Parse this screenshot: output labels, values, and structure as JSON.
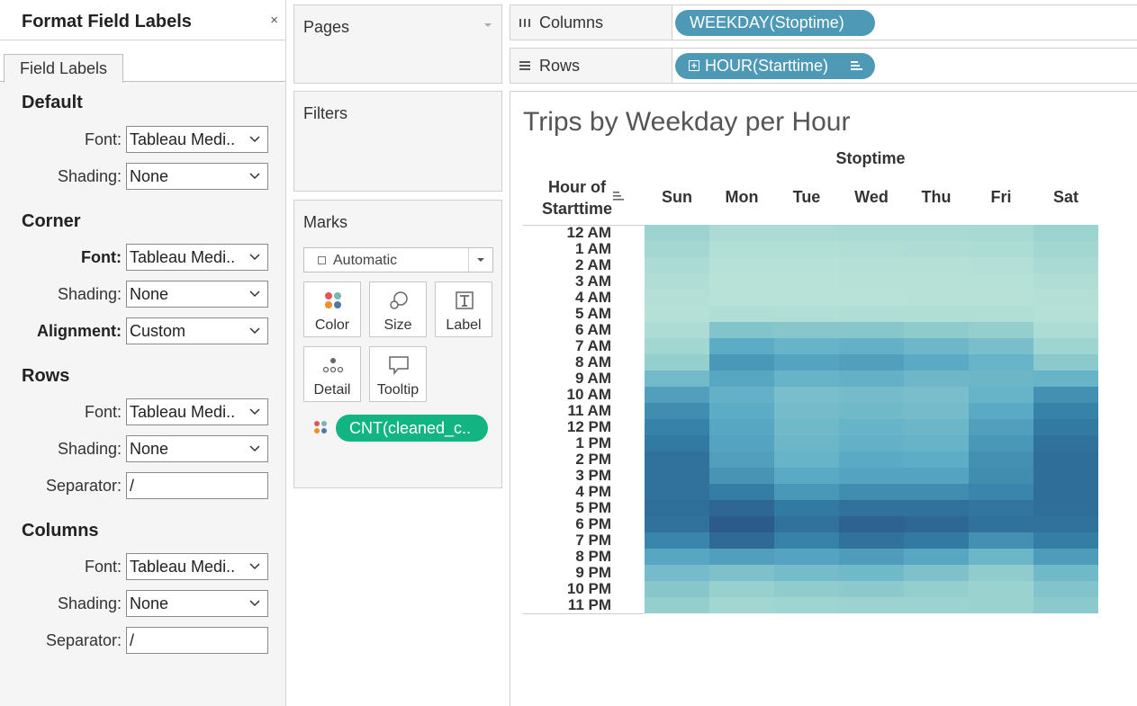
{
  "format_panel": {
    "title": "Format Field Labels",
    "close_glyph": "×",
    "tab": "Field Labels",
    "sections": {
      "default": {
        "title": "Default",
        "font_label": "Font:",
        "font_value": "Tableau Medi..",
        "shading_label": "Shading:",
        "shading_value": "None"
      },
      "corner": {
        "title": "Corner",
        "font_label": "Font:",
        "font_value": "Tableau Medi..",
        "shading_label": "Shading:",
        "shading_value": "None",
        "alignment_label": "Alignment:",
        "alignment_value": "Custom"
      },
      "rows": {
        "title": "Rows",
        "font_label": "Font:",
        "font_value": "Tableau Medi..",
        "shading_label": "Shading:",
        "shading_value": "None",
        "separator_label": "Separator:",
        "separator_value": "/"
      },
      "columns": {
        "title": "Columns",
        "font_label": "Font:",
        "font_value": "Tableau Medi..",
        "shading_label": "Shading:",
        "shading_value": "None",
        "separator_label": "Separator:",
        "separator_value": "/"
      }
    }
  },
  "pages": {
    "title": "Pages"
  },
  "filters": {
    "title": "Filters"
  },
  "marks": {
    "title": "Marks",
    "mark_type": "Automatic",
    "buttons": {
      "color": "Color",
      "size": "Size",
      "label": "Label",
      "detail": "Detail",
      "tooltip": "Tooltip"
    },
    "color_pill": "CNT(cleaned_c.."
  },
  "shelves": {
    "columns": {
      "label": "Columns",
      "pill": "WEEKDAY(Stoptime)"
    },
    "rows": {
      "label": "Rows",
      "pill": "HOUR(Starttime)"
    }
  },
  "view": {
    "title": "Trips by Weekday per Hour",
    "column_field": "Stoptime",
    "row_field": "Hour of Starttime",
    "row_field_line1": "Hour of",
    "row_field_line2": "Starttime"
  },
  "colors": {
    "pill_blue": "#4e99b6",
    "pill_green": "#12b582",
    "color_ramp_low": "#bce4d8",
    "color_ramp_high": "#2c5985"
  },
  "chart_data": {
    "type": "heatmap",
    "title": "Trips by Weekday per Hour",
    "xlabel": "Stoptime",
    "ylabel": "Hour of Starttime",
    "x": [
      "Sun",
      "Mon",
      "Tue",
      "Wed",
      "Thu",
      "Fri",
      "Sat"
    ],
    "y": [
      "12 AM",
      "1 AM",
      "2 AM",
      "3 AM",
      "4 AM",
      "5 AM",
      "6 AM",
      "7 AM",
      "8 AM",
      "9 AM",
      "10 AM",
      "11 AM",
      "12 PM",
      "1 PM",
      "2 PM",
      "3 PM",
      "4 PM",
      "5 PM",
      "6 PM",
      "7 PM",
      "8 PM",
      "9 PM",
      "10 PM",
      "11 PM"
    ],
    "color_scale": "relative intensity 0-1 (light green-teal to dark blue)",
    "values": [
      [
        0.24,
        0.13,
        0.13,
        0.14,
        0.14,
        0.16,
        0.25
      ],
      [
        0.18,
        0.08,
        0.08,
        0.09,
        0.1,
        0.11,
        0.2
      ],
      [
        0.13,
        0.05,
        0.05,
        0.06,
        0.06,
        0.07,
        0.14
      ],
      [
        0.09,
        0.03,
        0.03,
        0.04,
        0.04,
        0.05,
        0.09
      ],
      [
        0.07,
        0.03,
        0.03,
        0.03,
        0.04,
        0.04,
        0.07
      ],
      [
        0.06,
        0.09,
        0.08,
        0.09,
        0.09,
        0.09,
        0.06
      ],
      [
        0.12,
        0.38,
        0.36,
        0.36,
        0.33,
        0.3,
        0.12
      ],
      [
        0.2,
        0.55,
        0.5,
        0.52,
        0.47,
        0.42,
        0.22
      ],
      [
        0.3,
        0.66,
        0.6,
        0.62,
        0.56,
        0.5,
        0.34
      ],
      [
        0.45,
        0.58,
        0.5,
        0.52,
        0.47,
        0.48,
        0.5
      ],
      [
        0.62,
        0.52,
        0.42,
        0.44,
        0.42,
        0.5,
        0.7
      ],
      [
        0.72,
        0.55,
        0.44,
        0.46,
        0.44,
        0.56,
        0.78
      ],
      [
        0.78,
        0.58,
        0.46,
        0.5,
        0.48,
        0.62,
        0.82
      ],
      [
        0.82,
        0.6,
        0.48,
        0.52,
        0.5,
        0.66,
        0.86
      ],
      [
        0.86,
        0.62,
        0.5,
        0.56,
        0.54,
        0.7,
        0.88
      ],
      [
        0.86,
        0.68,
        0.56,
        0.6,
        0.6,
        0.72,
        0.88
      ],
      [
        0.86,
        0.8,
        0.66,
        0.72,
        0.72,
        0.76,
        0.88
      ],
      [
        0.88,
        0.92,
        0.82,
        0.86,
        0.86,
        0.84,
        0.88
      ],
      [
        0.86,
        0.98,
        0.86,
        0.94,
        0.92,
        0.86,
        0.86
      ],
      [
        0.76,
        0.9,
        0.78,
        0.86,
        0.82,
        0.7,
        0.8
      ],
      [
        0.58,
        0.62,
        0.6,
        0.64,
        0.58,
        0.48,
        0.64
      ],
      [
        0.44,
        0.4,
        0.44,
        0.46,
        0.4,
        0.32,
        0.46
      ],
      [
        0.36,
        0.28,
        0.32,
        0.34,
        0.3,
        0.26,
        0.38
      ],
      [
        0.3,
        0.2,
        0.22,
        0.24,
        0.24,
        0.26,
        0.34
      ]
    ]
  }
}
